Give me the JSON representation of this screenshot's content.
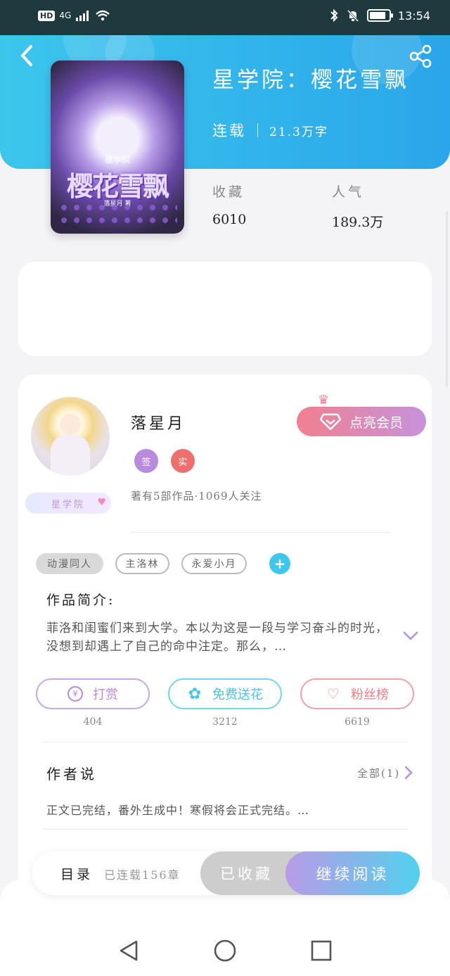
{
  "status_bar": {
    "network": "HD",
    "signal": "4G",
    "time": "13:54",
    "battery_level": 0.85
  },
  "book": {
    "title": "星学院：樱花雪飘",
    "cover_title": "樱花雪飘",
    "cover_subtitle": "星学院",
    "cover_author": "落星月 著",
    "status": "连载",
    "word_count": "21.3万字",
    "stats": {
      "favorites_label": "收藏",
      "favorites_value": "6010",
      "popularity_label": "人气",
      "popularity_value": "189.3万"
    }
  },
  "author": {
    "name": "落星月",
    "badge_text": "星学院",
    "chips": [
      "签",
      "实"
    ],
    "meta": "著有5部作品·1069人关注",
    "vip_button": "点亮会员"
  },
  "tags": [
    "动漫同人",
    "主洛林",
    "永爱小月"
  ],
  "intro": {
    "title": "作品简介:",
    "text": "菲洛和闺蜜们来到大学。本以为这是一段与学习奋斗的时光，没想到却遇上了自己的命中注定。那么，…"
  },
  "actions": [
    {
      "label": "打赏",
      "count": "404",
      "icon": "¥"
    },
    {
      "label": "免费送花",
      "count": "3212",
      "icon": "✿"
    },
    {
      "label": "粉丝榜",
      "count": "6619",
      "icon": "♡"
    }
  ],
  "author_says": {
    "title": "作者说",
    "all_label": "全部(1)",
    "text": "正文已完结，番外生成中！寒假将会正式完结。…"
  },
  "bottom_bar": {
    "toc_label": "目录",
    "toc_info": "已连载156章",
    "collected_label": "已收藏",
    "continue_label": "继续阅读"
  },
  "colors": {
    "header_start": "#3cc6ec",
    "header_end": "#2aa6ea",
    "vip_start": "#f27f8f",
    "vip_end": "#c693dc",
    "reward": "#b88ae0",
    "flower": "#3ec7ec",
    "fans": "#ef7d86"
  }
}
